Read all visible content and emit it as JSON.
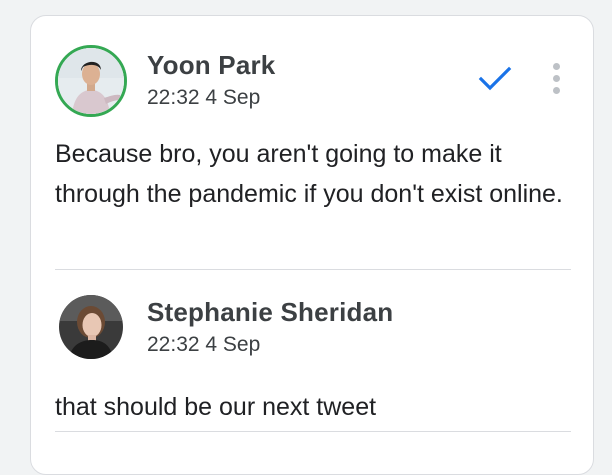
{
  "comments": [
    {
      "author": "Yoon Park",
      "timestamp": "22:32 4 Sep",
      "text": "Because bro, you aren't going to make it through the pandemic if you don't exist online.",
      "avatar_border_color": "#34a853",
      "actions": {
        "resolve_icon": "checkmark-icon",
        "resolve_color": "#1a73e8",
        "more_icon": "more-vert-icon"
      }
    },
    {
      "author": "Stephanie Sheridan",
      "timestamp": "22:32 4 Sep",
      "text": "that should be our next tweet"
    }
  ]
}
